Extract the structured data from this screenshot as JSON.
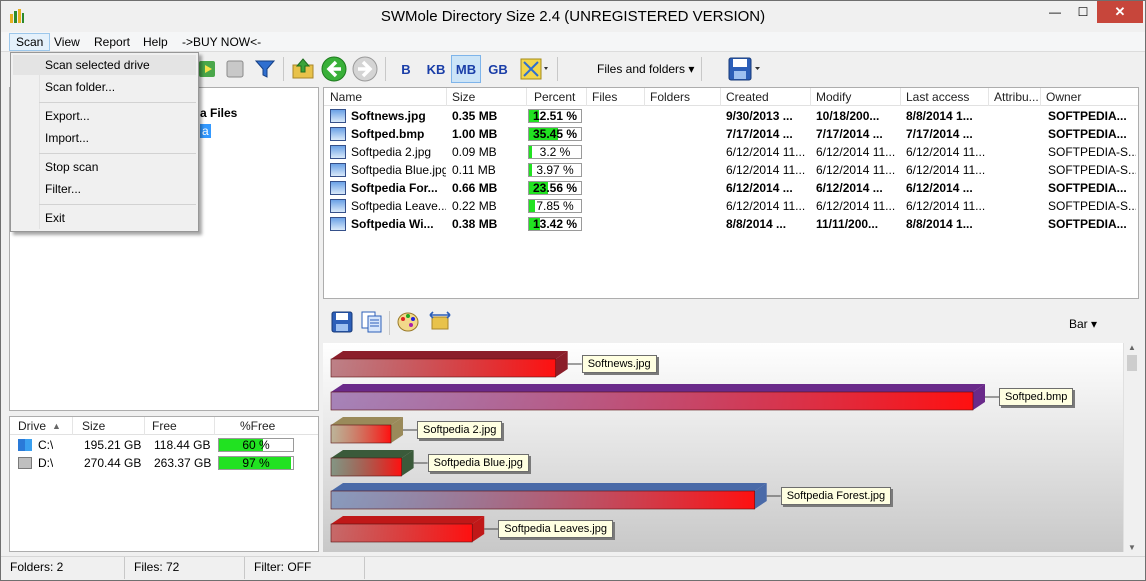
{
  "window": {
    "title": "SWMole Directory Size 2.4 (UNREGISTERED VERSION)",
    "min_symbol": "—",
    "max_symbol": "☐",
    "close_symbol": "✕"
  },
  "menubar": {
    "items": [
      "Scan",
      "View",
      "Report",
      "Help",
      "->BUY NOW<-"
    ]
  },
  "scan_menu": {
    "items": [
      "Scan selected drive",
      "Scan folder...",
      "Export...",
      "Import...",
      "Stop scan",
      "Filter...",
      "Exit"
    ]
  },
  "toolbar": {
    "units": [
      "B",
      "KB",
      "MB",
      "GB"
    ],
    "selected_unit": "MB",
    "view_dropdown": "Files and folders",
    "dropdown_arrow": "▾"
  },
  "tree": {
    "partial_label": "a Files",
    "partial_selected": "a"
  },
  "file_table": {
    "columns": [
      "Name",
      "Size",
      "Percent",
      "Files",
      "Folders",
      "Created",
      "Modify",
      "Last access",
      "Attribu...",
      "Owner"
    ],
    "rows": [
      {
        "name": "Softnews.jpg",
        "size": "0.35 MB",
        "percent": "12.51 %",
        "pct": 12.51,
        "files": "",
        "folders": "",
        "created": "9/30/2013 ...",
        "modify": "10/18/200...",
        "access": "8/8/2014 1...",
        "attr": "",
        "owner": "SOFTPEDIA...",
        "bold": true
      },
      {
        "name": "Softped.bmp",
        "size": "1.00 MB",
        "percent": "35.45 %",
        "pct": 35.45,
        "files": "",
        "folders": "",
        "created": "7/17/2014 ...",
        "modify": "7/17/2014 ...",
        "access": "7/17/2014 ...",
        "attr": "",
        "owner": "SOFTPEDIA...",
        "bold": true
      },
      {
        "name": "Softpedia 2.jpg",
        "size": "0.09 MB",
        "percent": "3.2 %",
        "pct": 3.2,
        "files": "",
        "folders": "",
        "created": "6/12/2014 11...",
        "modify": "6/12/2014 11...",
        "access": "6/12/2014 11...",
        "attr": "",
        "owner": "SOFTPEDIA-S...",
        "bold": false
      },
      {
        "name": "Softpedia Blue.jpg",
        "size": "0.11 MB",
        "percent": "3.97 %",
        "pct": 3.97,
        "files": "",
        "folders": "",
        "created": "6/12/2014 11...",
        "modify": "6/12/2014 11...",
        "access": "6/12/2014 11...",
        "attr": "",
        "owner": "SOFTPEDIA-S...",
        "bold": false
      },
      {
        "name": "Softpedia For...",
        "size": "0.66 MB",
        "percent": "23.56 %",
        "pct": 23.56,
        "files": "",
        "folders": "",
        "created": "6/12/2014 ...",
        "modify": "6/12/2014 ...",
        "access": "6/12/2014 ...",
        "attr": "",
        "owner": "SOFTPEDIA...",
        "bold": true
      },
      {
        "name": "Softpedia Leave...",
        "size": "0.22 MB",
        "percent": "7.85 %",
        "pct": 7.85,
        "files": "",
        "folders": "",
        "created": "6/12/2014 11...",
        "modify": "6/12/2014 11...",
        "access": "6/12/2014 11...",
        "attr": "",
        "owner": "SOFTPEDIA-S...",
        "bold": false
      },
      {
        "name": "Softpedia Wi...",
        "size": "0.38 MB",
        "percent": "13.42 %",
        "pct": 13.42,
        "files": "",
        "folders": "",
        "created": "8/8/2014 ...",
        "modify": "11/11/200...",
        "access": "8/8/2014 1...",
        "attr": "",
        "owner": "SOFTPEDIA...",
        "bold": true
      }
    ]
  },
  "chart_tools": {
    "type_dropdown": "Bar"
  },
  "chart_data": {
    "type": "bar",
    "categories": [
      "Softnews.jpg",
      "Softped.bmp",
      "Softpedia 2.jpg",
      "Softpedia Blue.jpg",
      "Softpedia Forest.jpg",
      "Softpedia Leaves.jpg"
    ],
    "values": [
      0.35,
      1.0,
      0.09,
      0.11,
      0.66,
      0.22
    ],
    "colors": [
      "#8b1e2a",
      "#6a2a8a",
      "#9a8a5a",
      "#3a5a3a",
      "#4a6aa8",
      "#c01818"
    ]
  },
  "drives": {
    "columns": [
      "Drive",
      "Size",
      "Free",
      "%Free"
    ],
    "rows": [
      {
        "drive": "C:\\",
        "size": "195.21 GB",
        "free": "118.44 GB",
        "pct_label": "60 %",
        "pct": 60
      },
      {
        "drive": "D:\\",
        "size": "270.44 GB",
        "free": "263.37 GB",
        "pct_label": "97 %",
        "pct": 97
      }
    ]
  },
  "status": {
    "folders": "Folders: 2",
    "files": "Files: 72",
    "filter": "Filter: OFF"
  }
}
